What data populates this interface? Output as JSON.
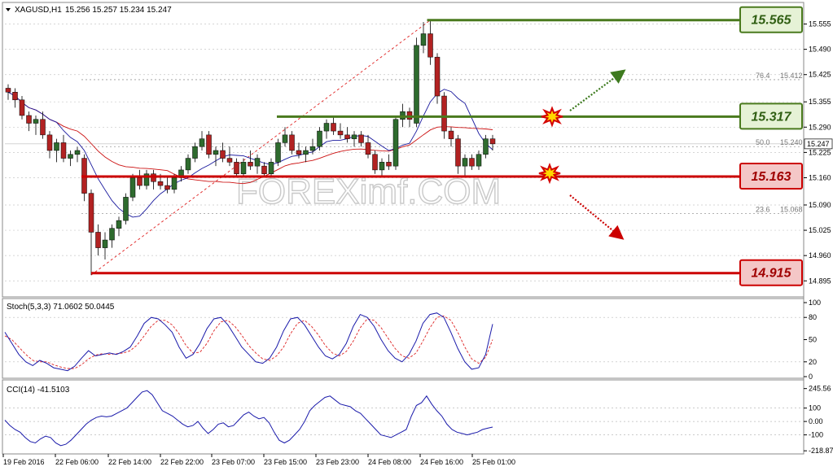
{
  "header": {
    "symbol": "XAGUSD,H1",
    "ohlc": "15.256 15.257 15.234 15.247"
  },
  "watermark": "FOREXimf.COM",
  "colors": {
    "bull": "#2e6b2e",
    "bear": "#b22222",
    "ma_fast": "#1a1a9e",
    "ma_slow": "#cc1111",
    "support": "#cc0000",
    "resistance": "#4a7a1e",
    "stoch_main": "#1a1aaa",
    "stoch_signal": "#dd2222",
    "cci": "#1a1aaa"
  },
  "chart_data": [
    {
      "type": "candlestick",
      "ylim": [
        14.86,
        15.6
      ],
      "y_ticks": [
        "15.555",
        "15.490",
        "15.425",
        "15.355",
        "15.290",
        "15.225",
        "15.160",
        "15.090",
        "15.025",
        "14.960",
        "14.895"
      ],
      "current_price": "15.247",
      "x_ticks": [
        "19 Feb 2016",
        "22 Feb 06:00",
        "22 Feb 14:00",
        "22 Feb 22:00",
        "23 Feb 07:00",
        "23 Feb 15:00",
        "23 Feb 23:00",
        "24 Feb 08:00",
        "24 Feb 16:00",
        "25 Feb 01:00"
      ],
      "candles": [
        [
          15.39,
          15.4,
          15.36,
          15.38
        ],
        [
          15.38,
          15.39,
          15.34,
          15.36
        ],
        [
          15.36,
          15.37,
          15.31,
          15.32
        ],
        [
          15.32,
          15.33,
          15.28,
          15.3
        ],
        [
          15.3,
          15.32,
          15.27,
          15.31
        ],
        [
          15.31,
          15.33,
          15.26,
          15.27
        ],
        [
          15.27,
          15.28,
          15.21,
          15.23
        ],
        [
          15.23,
          15.26,
          15.2,
          15.25
        ],
        [
          15.25,
          15.27,
          15.2,
          15.21
        ],
        [
          15.21,
          15.23,
          15.19,
          15.22
        ],
        [
          15.22,
          15.24,
          15.2,
          15.23
        ],
        [
          15.21,
          15.22,
          15.1,
          15.12
        ],
        [
          15.12,
          15.13,
          14.91,
          15.02
        ],
        [
          15.02,
          15.04,
          14.96,
          14.98
        ],
        [
          14.98,
          15.02,
          14.95,
          15.0
        ],
        [
          15.0,
          15.04,
          14.98,
          15.03
        ],
        [
          15.03,
          15.06,
          15.01,
          15.05
        ],
        [
          15.05,
          15.12,
          15.04,
          15.11
        ],
        [
          15.11,
          15.17,
          15.1,
          15.16
        ],
        [
          15.16,
          15.18,
          15.13,
          15.14
        ],
        [
          15.14,
          15.18,
          15.13,
          15.17
        ],
        [
          15.17,
          15.18,
          15.13,
          15.15
        ],
        [
          15.15,
          15.17,
          15.13,
          15.14
        ],
        [
          15.14,
          15.16,
          15.12,
          15.13
        ],
        [
          15.13,
          15.17,
          15.12,
          15.16
        ],
        [
          15.16,
          15.19,
          15.15,
          15.18
        ],
        [
          15.18,
          15.22,
          15.17,
          15.21
        ],
        [
          15.21,
          15.25,
          15.2,
          15.24
        ],
        [
          15.24,
          15.28,
          15.23,
          15.26
        ],
        [
          15.27,
          15.28,
          15.21,
          15.22
        ],
        [
          15.22,
          15.24,
          15.19,
          15.23
        ],
        [
          15.23,
          15.25,
          15.2,
          15.21
        ],
        [
          15.21,
          15.24,
          15.19,
          15.2
        ],
        [
          15.2,
          15.21,
          15.16,
          15.17
        ],
        [
          15.17,
          15.21,
          15.16,
          15.2
        ],
        [
          15.2,
          15.23,
          15.18,
          15.19
        ],
        [
          15.19,
          15.22,
          15.17,
          15.21
        ],
        [
          15.19,
          15.2,
          15.16,
          15.17
        ],
        [
          15.17,
          15.21,
          15.16,
          15.2
        ],
        [
          15.2,
          15.26,
          15.19,
          15.25
        ],
        [
          15.25,
          15.29,
          15.24,
          15.27
        ],
        [
          15.27,
          15.28,
          15.22,
          15.23
        ],
        [
          15.23,
          15.25,
          15.21,
          15.22
        ],
        [
          15.22,
          15.24,
          15.2,
          15.23
        ],
        [
          15.23,
          15.26,
          15.22,
          15.24
        ],
        [
          15.24,
          15.29,
          15.23,
          15.28
        ],
        [
          15.28,
          15.31,
          15.26,
          15.3
        ],
        [
          15.3,
          15.32,
          15.27,
          15.28
        ],
        [
          15.28,
          15.3,
          15.26,
          15.27
        ],
        [
          15.27,
          15.29,
          15.25,
          15.26
        ],
        [
          15.26,
          15.28,
          15.24,
          15.27
        ],
        [
          15.27,
          15.28,
          15.24,
          15.25
        ],
        [
          15.25,
          15.27,
          15.21,
          15.22
        ],
        [
          15.22,
          15.23,
          15.17,
          15.18
        ],
        [
          15.18,
          15.21,
          15.16,
          15.2
        ],
        [
          15.2,
          15.22,
          15.18,
          15.19
        ],
        [
          15.19,
          15.32,
          15.18,
          15.31
        ],
        [
          15.31,
          15.35,
          15.29,
          15.33
        ],
        [
          15.33,
          15.34,
          15.29,
          15.31
        ],
        [
          15.3,
          15.52,
          15.29,
          15.5
        ],
        [
          15.5,
          15.56,
          15.48,
          15.53
        ],
        [
          15.53,
          15.565,
          15.45,
          15.47
        ],
        [
          15.47,
          15.48,
          15.35,
          15.37
        ],
        [
          15.37,
          15.38,
          15.26,
          15.28
        ],
        [
          15.28,
          15.29,
          15.24,
          15.26
        ],
        [
          15.26,
          15.27,
          15.17,
          15.19
        ],
        [
          15.19,
          15.22,
          15.16,
          15.21
        ],
        [
          15.21,
          15.22,
          15.18,
          15.19
        ],
        [
          15.19,
          15.23,
          15.18,
          15.22
        ],
        [
          15.22,
          15.27,
          15.21,
          15.26
        ],
        [
          15.26,
          15.27,
          15.23,
          15.247
        ]
      ],
      "fibonacci": [
        {
          "label": "76.4",
          "value": "15.412"
        },
        {
          "label": "50.0",
          "value": "15.240"
        },
        {
          "label": "23.6",
          "value": "15.068"
        }
      ],
      "levels": [
        {
          "value": 15.565,
          "label": "15.565",
          "kind": "resistance"
        },
        {
          "value": 15.317,
          "label": "15.317",
          "kind": "resistance"
        },
        {
          "value": 15.163,
          "label": "15.163",
          "kind": "support"
        },
        {
          "value": 14.915,
          "label": "14.915",
          "kind": "support"
        }
      ]
    },
    {
      "type": "line",
      "header": "Stoch(5,3,3) 71.0602 50.0445",
      "ylim": [
        0,
        100
      ],
      "y_ticks": [
        "100",
        "80",
        "50",
        "20",
        "0"
      ],
      "series": [
        {
          "values": [
            60,
            45,
            30,
            20,
            15,
            22,
            18,
            12,
            10,
            8,
            14,
            25,
            35,
            28,
            30,
            32,
            30,
            34,
            40,
            55,
            72,
            80,
            78,
            70,
            60,
            40,
            25,
            30,
            45,
            65,
            78,
            80,
            70,
            55,
            40,
            30,
            20,
            18,
            25,
            40,
            62,
            78,
            80,
            70,
            55,
            40,
            28,
            24,
            30,
            45,
            68,
            84,
            80,
            68,
            50,
            35,
            25,
            20,
            30,
            48,
            72,
            84,
            86,
            80,
            60,
            38,
            20,
            10,
            12,
            30,
            71
          ]
        },
        {
          "values": [
            55,
            50,
            40,
            30,
            22,
            20,
            20,
            16,
            13,
            11,
            11,
            16,
            24,
            29,
            31,
            30,
            31,
            32,
            35,
            43,
            55,
            68,
            76,
            76,
            70,
            58,
            42,
            32,
            33,
            45,
            62,
            74,
            76,
            68,
            56,
            42,
            32,
            24,
            22,
            28,
            40,
            58,
            72,
            76,
            68,
            56,
            42,
            32,
            28,
            34,
            48,
            66,
            78,
            76,
            66,
            52,
            38,
            28,
            25,
            32,
            48,
            66,
            80,
            82,
            76,
            60,
            40,
            24,
            18,
            26,
            50
          ]
        }
      ]
    },
    {
      "type": "line",
      "header": "CCI(14) -41.5103",
      "ylim": [
        -230,
        280
      ],
      "y_ticks": [
        "245.56",
        "100",
        "0.00",
        "-100",
        "-218.87"
      ],
      "series": [
        {
          "values": [
            10,
            -30,
            -60,
            -80,
            -120,
            -150,
            -160,
            -130,
            -110,
            -120,
            -160,
            -180,
            -170,
            -140,
            -100,
            -60,
            -20,
            10,
            30,
            40,
            35,
            40,
            60,
            80,
            100,
            140,
            180,
            220,
            230,
            200,
            140,
            80,
            60,
            40,
            10,
            -20,
            -40,
            -30,
            0,
            -50,
            -90,
            -60,
            -20,
            -10,
            -40,
            -30,
            10,
            50,
            70,
            40,
            20,
            30,
            -10,
            -80,
            -140,
            -160,
            -140,
            -100,
            -60,
            0,
            80,
            120,
            150,
            180,
            190,
            160,
            130,
            120,
            110,
            80,
            60,
            20,
            -20,
            -60,
            -100,
            -110,
            -120,
            -100,
            -80,
            -60,
            40,
            120,
            140,
            190,
            130,
            80,
            40,
            -20,
            -60,
            -80,
            -90,
            -100,
            -90,
            -80,
            -60,
            -50,
            -41.5
          ]
        }
      ]
    }
  ]
}
